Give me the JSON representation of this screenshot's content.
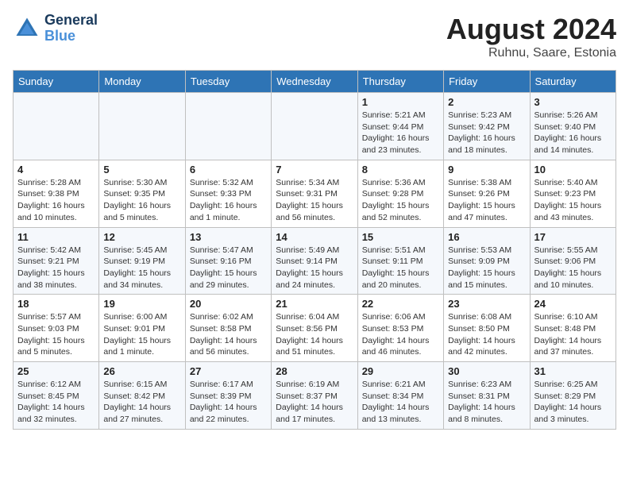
{
  "header": {
    "logo_line1": "General",
    "logo_line2": "Blue",
    "month_title": "August 2024",
    "location": "Ruhnu, Saare, Estonia"
  },
  "days_of_week": [
    "Sunday",
    "Monday",
    "Tuesday",
    "Wednesday",
    "Thursday",
    "Friday",
    "Saturday"
  ],
  "weeks": [
    [
      {
        "day": "",
        "info": ""
      },
      {
        "day": "",
        "info": ""
      },
      {
        "day": "",
        "info": ""
      },
      {
        "day": "",
        "info": ""
      },
      {
        "day": "1",
        "info": "Sunrise: 5:21 AM\nSunset: 9:44 PM\nDaylight: 16 hours\nand 23 minutes."
      },
      {
        "day": "2",
        "info": "Sunrise: 5:23 AM\nSunset: 9:42 PM\nDaylight: 16 hours\nand 18 minutes."
      },
      {
        "day": "3",
        "info": "Sunrise: 5:26 AM\nSunset: 9:40 PM\nDaylight: 16 hours\nand 14 minutes."
      }
    ],
    [
      {
        "day": "4",
        "info": "Sunrise: 5:28 AM\nSunset: 9:38 PM\nDaylight: 16 hours\nand 10 minutes."
      },
      {
        "day": "5",
        "info": "Sunrise: 5:30 AM\nSunset: 9:35 PM\nDaylight: 16 hours\nand 5 minutes."
      },
      {
        "day": "6",
        "info": "Sunrise: 5:32 AM\nSunset: 9:33 PM\nDaylight: 16 hours\nand 1 minute."
      },
      {
        "day": "7",
        "info": "Sunrise: 5:34 AM\nSunset: 9:31 PM\nDaylight: 15 hours\nand 56 minutes."
      },
      {
        "day": "8",
        "info": "Sunrise: 5:36 AM\nSunset: 9:28 PM\nDaylight: 15 hours\nand 52 minutes."
      },
      {
        "day": "9",
        "info": "Sunrise: 5:38 AM\nSunset: 9:26 PM\nDaylight: 15 hours\nand 47 minutes."
      },
      {
        "day": "10",
        "info": "Sunrise: 5:40 AM\nSunset: 9:23 PM\nDaylight: 15 hours\nand 43 minutes."
      }
    ],
    [
      {
        "day": "11",
        "info": "Sunrise: 5:42 AM\nSunset: 9:21 PM\nDaylight: 15 hours\nand 38 minutes."
      },
      {
        "day": "12",
        "info": "Sunrise: 5:45 AM\nSunset: 9:19 PM\nDaylight: 15 hours\nand 34 minutes."
      },
      {
        "day": "13",
        "info": "Sunrise: 5:47 AM\nSunset: 9:16 PM\nDaylight: 15 hours\nand 29 minutes."
      },
      {
        "day": "14",
        "info": "Sunrise: 5:49 AM\nSunset: 9:14 PM\nDaylight: 15 hours\nand 24 minutes."
      },
      {
        "day": "15",
        "info": "Sunrise: 5:51 AM\nSunset: 9:11 PM\nDaylight: 15 hours\nand 20 minutes."
      },
      {
        "day": "16",
        "info": "Sunrise: 5:53 AM\nSunset: 9:09 PM\nDaylight: 15 hours\nand 15 minutes."
      },
      {
        "day": "17",
        "info": "Sunrise: 5:55 AM\nSunset: 9:06 PM\nDaylight: 15 hours\nand 10 minutes."
      }
    ],
    [
      {
        "day": "18",
        "info": "Sunrise: 5:57 AM\nSunset: 9:03 PM\nDaylight: 15 hours\nand 5 minutes."
      },
      {
        "day": "19",
        "info": "Sunrise: 6:00 AM\nSunset: 9:01 PM\nDaylight: 15 hours\nand 1 minute."
      },
      {
        "day": "20",
        "info": "Sunrise: 6:02 AM\nSunset: 8:58 PM\nDaylight: 14 hours\nand 56 minutes."
      },
      {
        "day": "21",
        "info": "Sunrise: 6:04 AM\nSunset: 8:56 PM\nDaylight: 14 hours\nand 51 minutes."
      },
      {
        "day": "22",
        "info": "Sunrise: 6:06 AM\nSunset: 8:53 PM\nDaylight: 14 hours\nand 46 minutes."
      },
      {
        "day": "23",
        "info": "Sunrise: 6:08 AM\nSunset: 8:50 PM\nDaylight: 14 hours\nand 42 minutes."
      },
      {
        "day": "24",
        "info": "Sunrise: 6:10 AM\nSunset: 8:48 PM\nDaylight: 14 hours\nand 37 minutes."
      }
    ],
    [
      {
        "day": "25",
        "info": "Sunrise: 6:12 AM\nSunset: 8:45 PM\nDaylight: 14 hours\nand 32 minutes."
      },
      {
        "day": "26",
        "info": "Sunrise: 6:15 AM\nSunset: 8:42 PM\nDaylight: 14 hours\nand 27 minutes."
      },
      {
        "day": "27",
        "info": "Sunrise: 6:17 AM\nSunset: 8:39 PM\nDaylight: 14 hours\nand 22 minutes."
      },
      {
        "day": "28",
        "info": "Sunrise: 6:19 AM\nSunset: 8:37 PM\nDaylight: 14 hours\nand 17 minutes."
      },
      {
        "day": "29",
        "info": "Sunrise: 6:21 AM\nSunset: 8:34 PM\nDaylight: 14 hours\nand 13 minutes."
      },
      {
        "day": "30",
        "info": "Sunrise: 6:23 AM\nSunset: 8:31 PM\nDaylight: 14 hours\nand 8 minutes."
      },
      {
        "day": "31",
        "info": "Sunrise: 6:25 AM\nSunset: 8:29 PM\nDaylight: 14 hours\nand 3 minutes."
      }
    ]
  ]
}
